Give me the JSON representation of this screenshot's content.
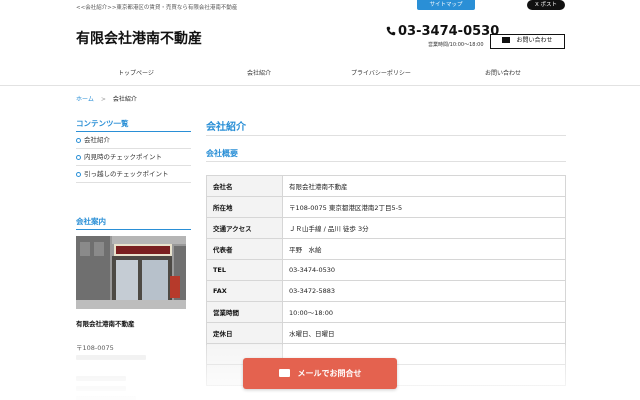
{
  "topbar": {
    "tagline": "<<会社紹介>>東京都港区の賃貸・売買なら有限会社港南不動産",
    "sitemap_label": "サイトマップ",
    "x_post_label": "X ポスト"
  },
  "header": {
    "company_name": "有限会社港南不動産",
    "phone": "03-3474-0530",
    "hours": "営業時間/10:00〜18:00",
    "contact_label": "お問い合わせ"
  },
  "nav": {
    "items": [
      {
        "label": "トップページ"
      },
      {
        "label": "会社紹介"
      },
      {
        "label": "プライバシーポリシー"
      },
      {
        "label": "お問い合わせ"
      }
    ]
  },
  "breadcrumb": {
    "home": "ホーム",
    "separator": ">",
    "current": "会社紹介"
  },
  "sidebar": {
    "contents_heading": "コンテンツ一覧",
    "items": [
      {
        "label": "会社紹介"
      },
      {
        "label": "内見時のチェックポイント"
      },
      {
        "label": "引っ越しのチェックポイント"
      }
    ],
    "info_heading": "会社案内",
    "shop_name": "有限会社港南不動産",
    "shop_zip": "〒108-0075"
  },
  "main": {
    "page_title": "会社紹介",
    "section_title": "会社概要",
    "rows": [
      {
        "label": "会社名",
        "value": "有限会社港南不動産"
      },
      {
        "label": "所在地",
        "value": "〒108-0075 東京都港区港南2丁目5-5"
      },
      {
        "label": "交通アクセス",
        "value": "ＪＲ山手線 / 品川 徒歩 3分"
      },
      {
        "label": "代表者",
        "value": "平野　水絵"
      },
      {
        "label": "TEL",
        "value": "03-3474-0530"
      },
      {
        "label": "FAX",
        "value": "03-3472-5883"
      },
      {
        "label": "営業時間",
        "value": "10:00〜18:00"
      },
      {
        "label": "定休日",
        "value": "水曜日、日曜日"
      }
    ]
  },
  "cta": {
    "mail_label": "メールでお問合せ"
  },
  "colors": {
    "accent": "#2a8fd6",
    "cta": "#e4624f"
  }
}
